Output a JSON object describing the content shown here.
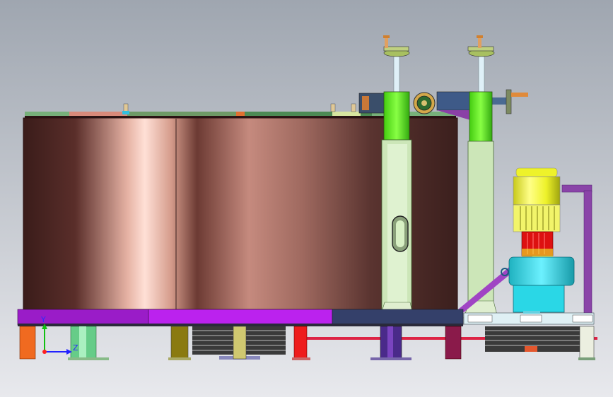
{
  "viewport": {
    "background_top": "#9fa6b0",
    "background_bottom": "#e8e9ed"
  },
  "axis_triad": {
    "y_label": "Y",
    "z_label": "Z",
    "y_color": "#11c011",
    "z_color": "#2222ff",
    "x_color": "#ff2020"
  },
  "colors": {
    "tank_dark": "#3a1c1a",
    "tank_light": "#ffd9cf",
    "column_green": "#66ee22",
    "column_pale": "#cce6b8",
    "motor_yellow": "#eef22a",
    "motor_red": "#dd1111",
    "gearbox_cyan": "#2ad7e6",
    "frame_purple": "#9a1cc8",
    "frame_magenta": "#bb22ee",
    "frame_navy": "#34406a",
    "stand_purple": "#8a44a8",
    "belt_red": "#dd2244"
  }
}
